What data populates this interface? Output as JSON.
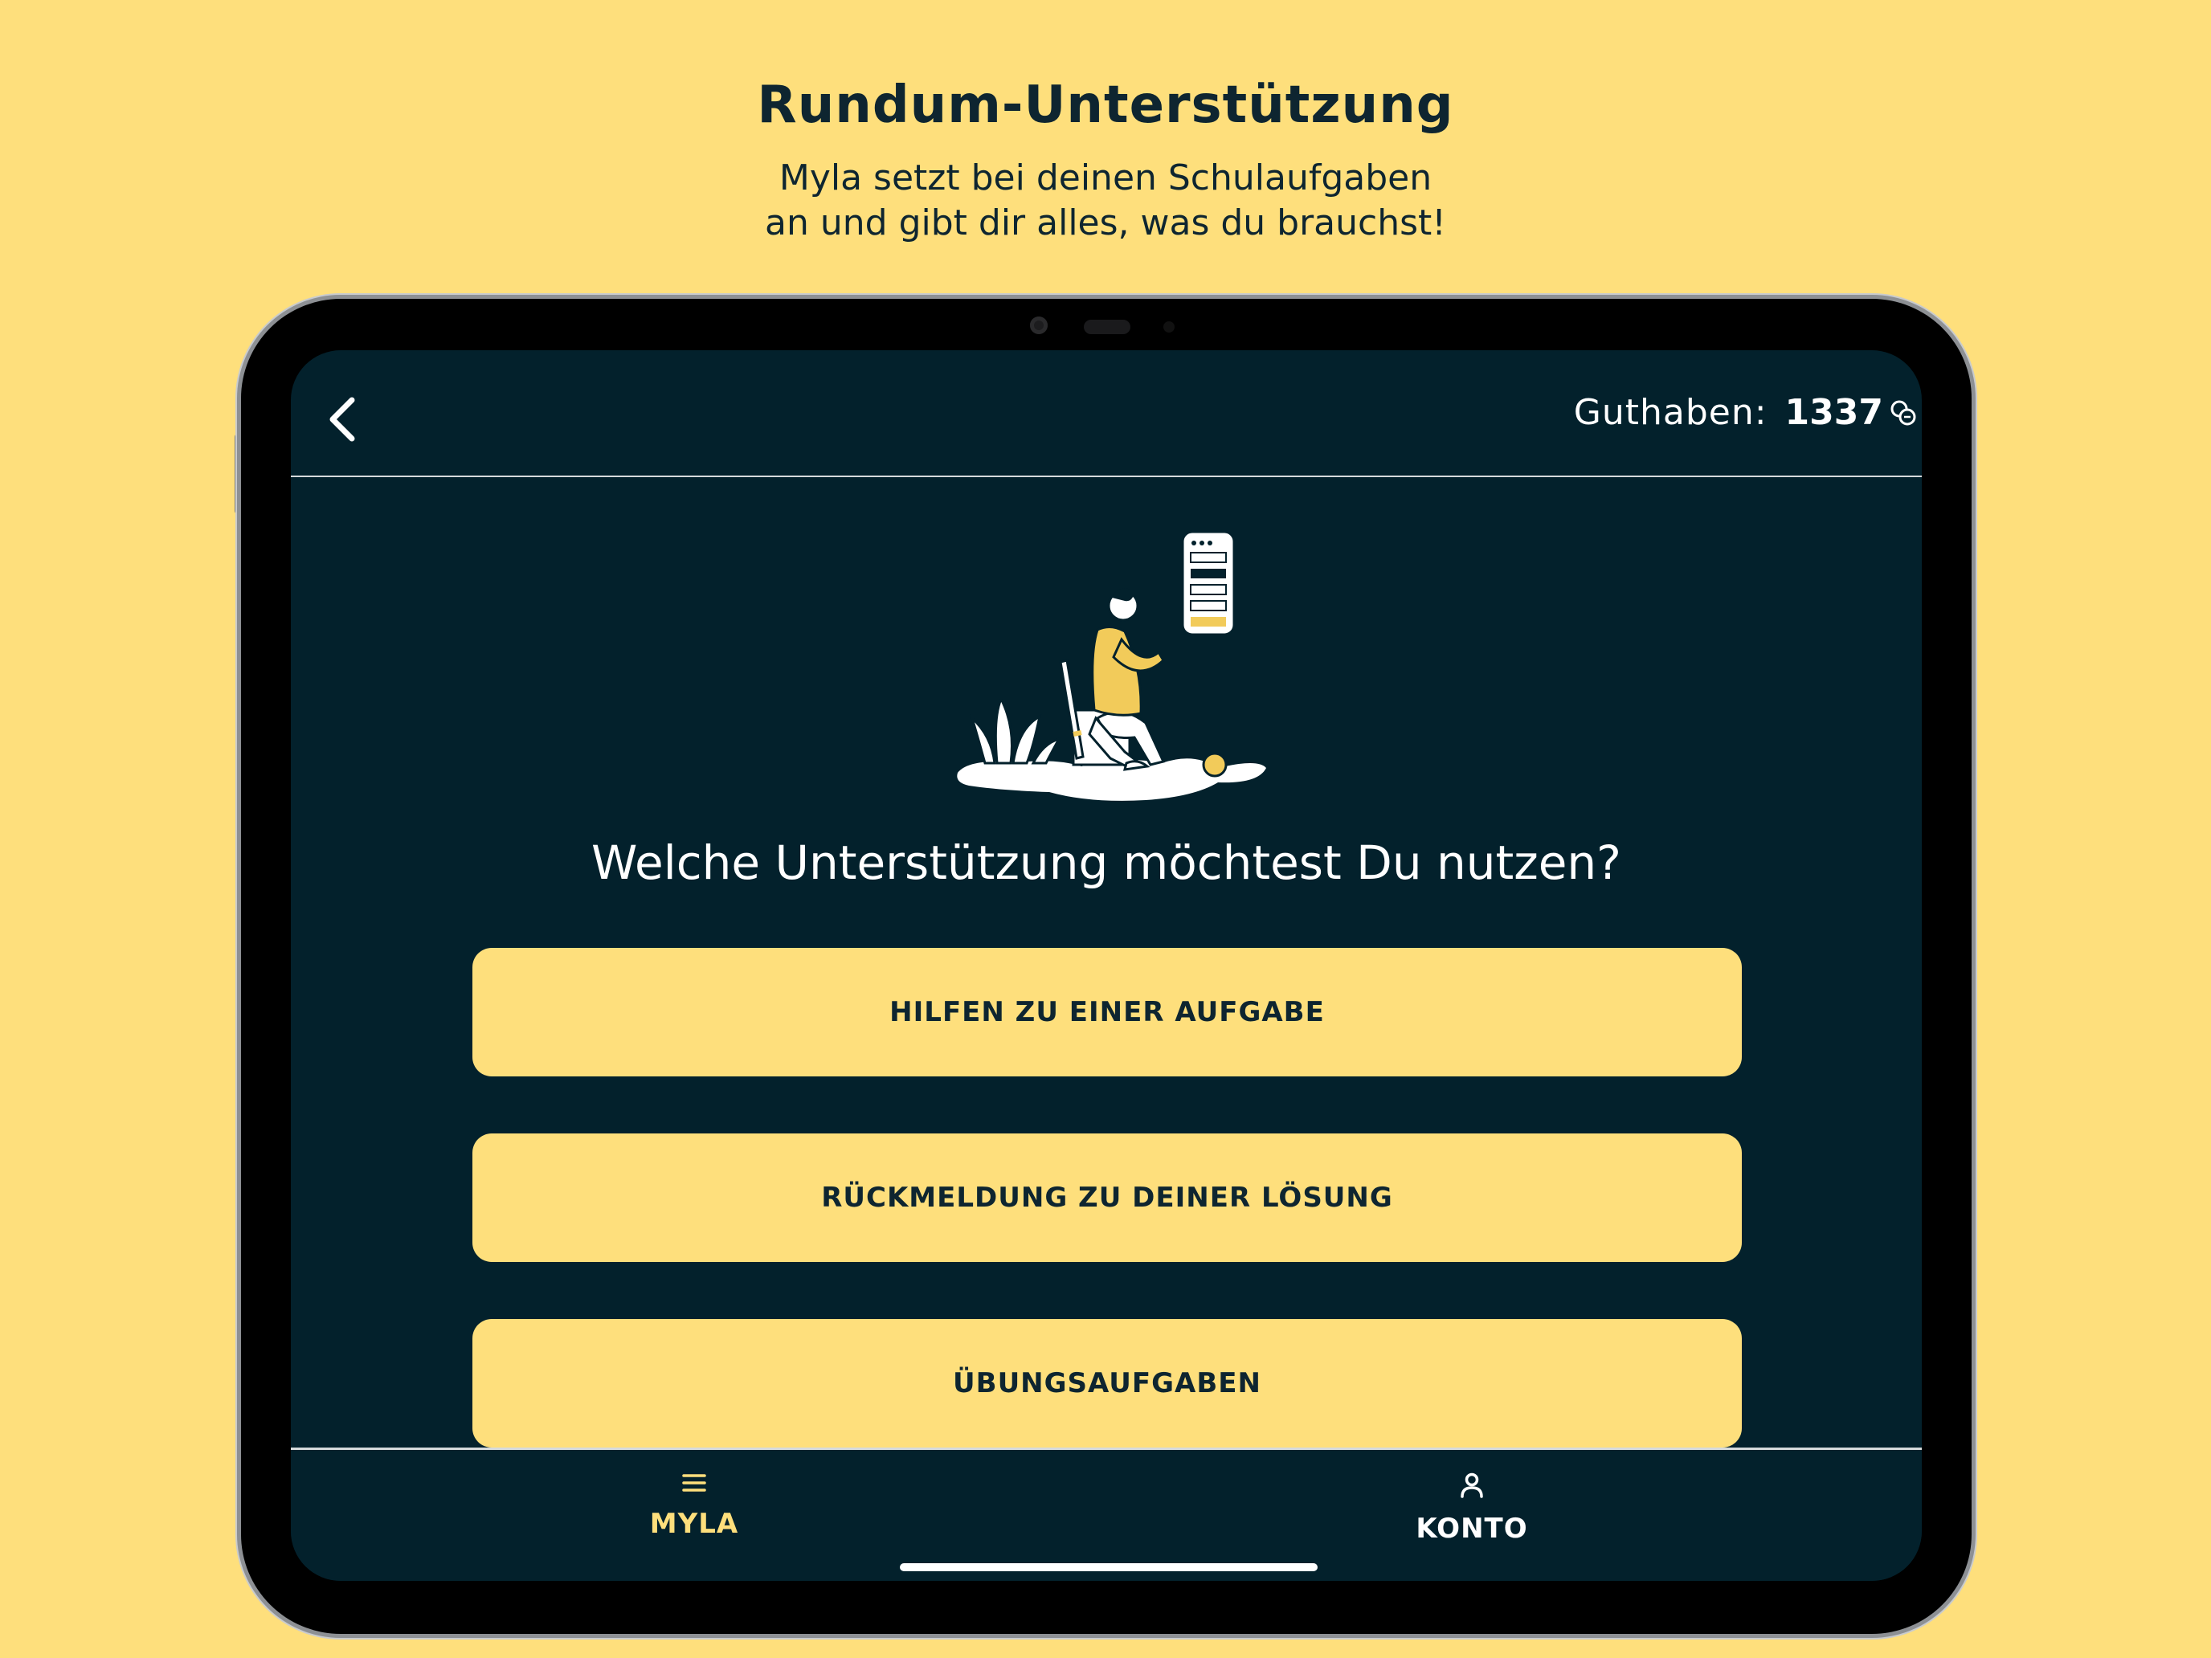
{
  "header": {
    "title": "Rundum-Unterstützung",
    "subtitle_lines": [
      "Myla setzt bei deinen Schulaufgaben",
      "an und gibt dir alles, was du brauchst!"
    ]
  },
  "topbar": {
    "back_icon": "chevron-left-icon",
    "balance_label": "Guthaben:",
    "balance_value": "1337",
    "coin_icon": "coins-icon"
  },
  "main": {
    "question": "Welche Unterstützung möchtest Du nutzen?",
    "options": [
      {
        "label": "HILFEN ZU EINER AUFGABE"
      },
      {
        "label": "RÜCKMELDUNG ZU DEINER LÖSUNG"
      },
      {
        "label": "ÜBUNGSAUFGABEN"
      }
    ]
  },
  "tabbar": {
    "tabs": [
      {
        "label": "MYLA",
        "icon": "menu-icon",
        "active": true
      },
      {
        "label": "KONTO",
        "icon": "user-icon",
        "active": false
      }
    ]
  },
  "colors": {
    "background": "#FEDF7C",
    "screen": "#03212C",
    "accent": "#FEDF7C",
    "text_dark": "#0E2530"
  }
}
